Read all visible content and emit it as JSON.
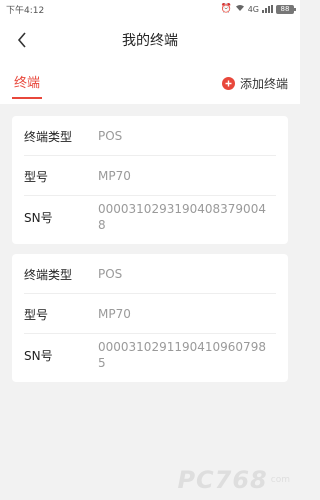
{
  "status": {
    "time": "下午4:12",
    "network": "4G",
    "battery": "88"
  },
  "header": {
    "title": "我的终端"
  },
  "tabs": {
    "active_label": "终端",
    "add_label": "添加终端"
  },
  "terminals": [
    {
      "type_label": "终端类型",
      "type_value": "POS",
      "model_label": "型号",
      "model_value": "MP70",
      "sn_label": "SN号",
      "sn_value": "0000310293190408379004 8"
    },
    {
      "type_label": "终端类型",
      "type_value": "POS",
      "model_label": "型号",
      "model_value": "MP70",
      "sn_label": "SN号",
      "sn_value": "0000310291190410960798 5"
    }
  ],
  "watermark": {
    "brand": "PC768",
    "sub": "com"
  },
  "colors": {
    "accent": "#e8473b",
    "background": "#f2f2f2"
  }
}
